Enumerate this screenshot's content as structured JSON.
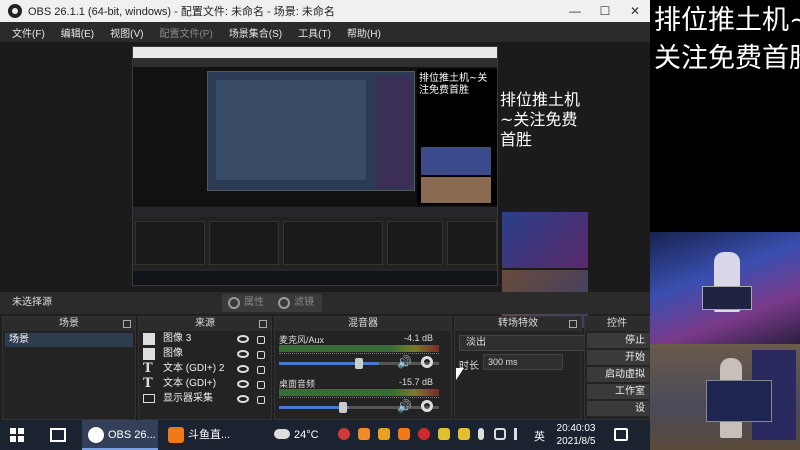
{
  "window": {
    "title": "OBS 26.1.1 (64-bit, windows) - 配置文件: 未命名 - 场景: 未命名",
    "minimize": "—",
    "maximize": "☐",
    "close": "✕"
  },
  "menu": [
    {
      "label": "文件(F)",
      "disabled": false
    },
    {
      "label": "编辑(E)",
      "disabled": false
    },
    {
      "label": "视图(V)",
      "disabled": false
    },
    {
      "label": "配置文件(P)",
      "disabled": true
    },
    {
      "label": "场景集合(S)",
      "disabled": false
    },
    {
      "label": "工具(T)",
      "disabled": false
    },
    {
      "label": "帮助(H)",
      "disabled": false
    }
  ],
  "preview": {
    "overlay_text": "排位推土机~关注免费首胜"
  },
  "source_bar": {
    "no_source": "未选择源",
    "properties": "属性",
    "filters": "滤镜"
  },
  "docks": {
    "scenes": {
      "title": "场景",
      "items": [
        "场景"
      ]
    },
    "sources": {
      "title": "来源",
      "items": [
        {
          "label": "图像 3",
          "icon": "image-icon"
        },
        {
          "label": "图像",
          "icon": "image-icon"
        },
        {
          "label": "文本 (GDI+) 2",
          "icon": "text-icon"
        },
        {
          "label": "文本 (GDI+)",
          "icon": "text-icon"
        },
        {
          "label": "显示器采集",
          "icon": "monitor-icon"
        }
      ]
    },
    "mixer": {
      "title": "混音器",
      "channels": [
        {
          "name": "麦克风/Aux",
          "db": "-4.1 dB",
          "level": 0.72
        },
        {
          "name": "桌面音频",
          "db": "-15.7 dB",
          "level": 0.55
        }
      ]
    },
    "transitions": {
      "title": "转场特效",
      "selected": "淡出",
      "duration_label": "时长",
      "duration_value": "300 ms"
    },
    "controls": {
      "title": "控件",
      "buttons": [
        "停止",
        "开始",
        "启动虚拟",
        "工作室",
        "设"
      ]
    }
  },
  "taskbar": {
    "apps": [
      {
        "label": "OBS 26...",
        "active": true,
        "color": "#ffffff"
      },
      {
        "label": "斗鱼直...",
        "active": false,
        "color": "#f07a1a"
      }
    ],
    "weather": "24°C",
    "ime": "英",
    "time": "20:40:03",
    "date": "2021/8/5"
  },
  "right_overlay": {
    "line1": "排位推土机~",
    "line2": "关注免费首胜"
  },
  "colors": {
    "obs_bg": "#1f1f1f",
    "selected_scene": "#2f3b4f",
    "taskbar": "#1b2230",
    "accent_blue": "#4a7ad0"
  }
}
